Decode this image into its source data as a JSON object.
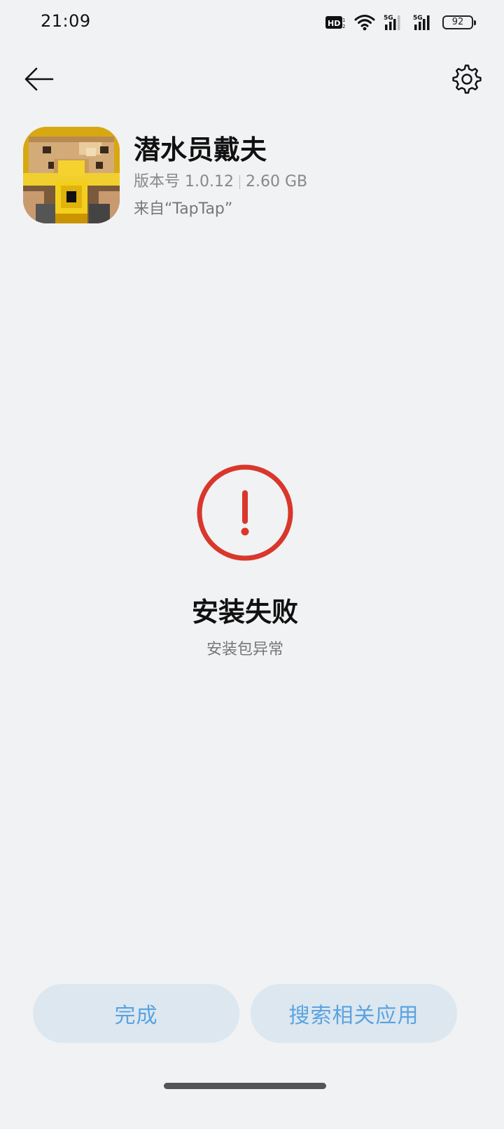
{
  "status_bar": {
    "time": "21:09",
    "battery": "92",
    "icons": [
      "hd-voice-icon",
      "wifi-icon",
      "5g-signal-icon",
      "5g-signal-icon",
      "battery-icon"
    ]
  },
  "nav": {
    "back_icon": "arrow-left-icon",
    "settings_icon": "gear-icon"
  },
  "app": {
    "name": "潜水员戴夫",
    "version": "版本号 1.0.12",
    "size": "2.60 GB",
    "source": "来自“TapTap”",
    "icon": "pixel-diver-app-icon"
  },
  "result": {
    "icon": "error-exclamation-icon",
    "title": "安装失败",
    "subtitle": "安装包异常",
    "accent_color": "#d9372b"
  },
  "actions": {
    "done_label": "完成",
    "search_label": "搜索相关应用",
    "button_bg": "#dce7f0",
    "button_text_color": "#5aa3e0"
  }
}
